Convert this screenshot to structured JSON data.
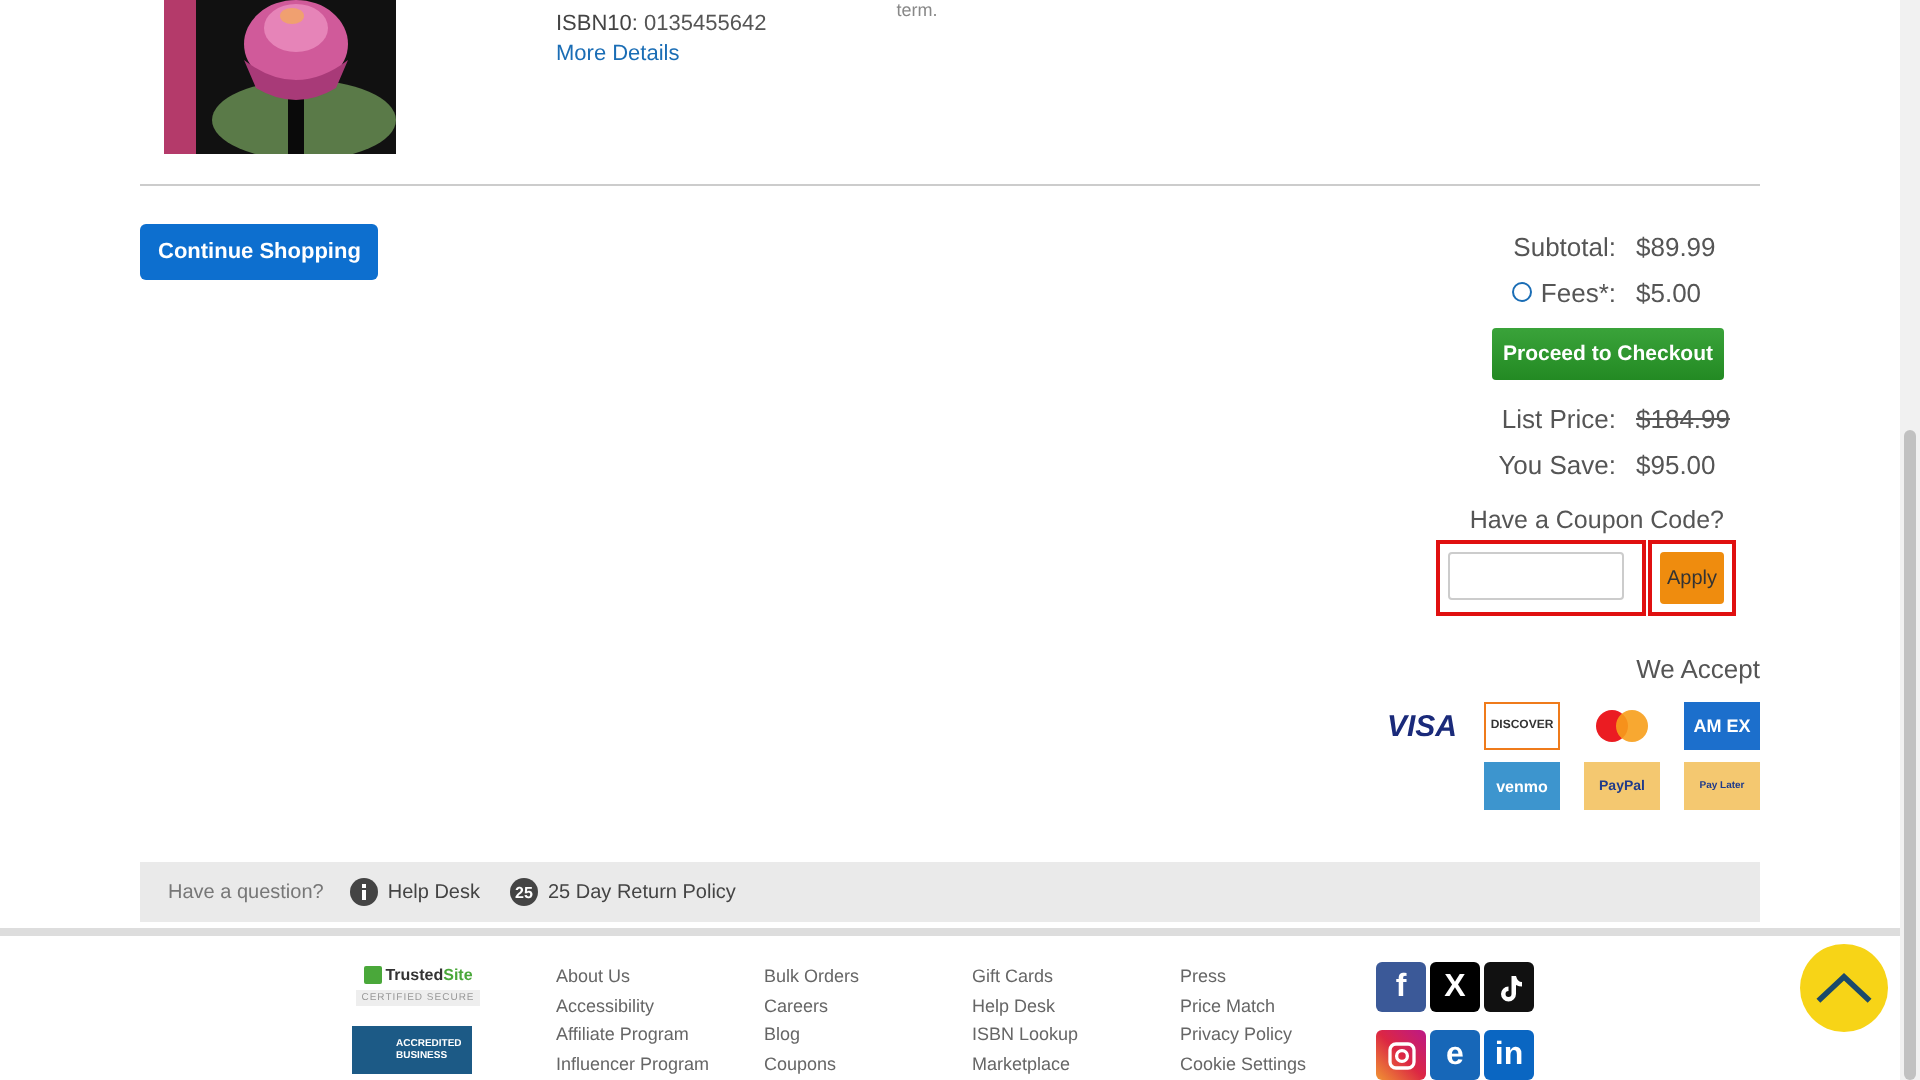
{
  "product": {
    "isbn10_label": "ISBN10:",
    "isbn10": "0135455642",
    "details_link": "More Details",
    "note": "term."
  },
  "continue_button": "Continue Shopping",
  "summary": {
    "rows": [
      {
        "label": "Subtotal:",
        "value": "$89.99",
        "info": false,
        "struck": false
      },
      {
        "label": "Fees*:",
        "value": "$5.00",
        "info": true,
        "struck": false
      }
    ],
    "checkout_button": "Proceed to Checkout",
    "savings": [
      {
        "label": "List Price:",
        "value": "$184.99",
        "struck": true
      },
      {
        "label": "You Save:",
        "value": "$95.00",
        "struck": false
      }
    ],
    "coupon_label": "Have a Coupon Code?",
    "apply_button": "Apply",
    "accept_label": "We Accept"
  },
  "payments": [
    {
      "label": "VISA",
      "kind": "plain"
    },
    {
      "label": "DISCOVER",
      "kind": "discover"
    },
    {
      "kind": "circles"
    },
    {
      "label": "AM EX",
      "kind": "amex"
    },
    {
      "label": "venmo",
      "kind": "venmo"
    },
    {
      "label": "PayPal",
      "kind": "paypal"
    },
    {
      "label": "Pay Later",
      "kind": "paylater"
    }
  ],
  "help_bar": {
    "question": "Have a question?",
    "help_desk": "Help Desk",
    "return_badge": "25",
    "return_policy": "25 Day Return Policy"
  },
  "badges": {
    "trusted_a": "Trusted",
    "trusted_b": "Site",
    "certified": "CERTIFIED SECURE",
    "bbb": "ACCREDITED BUSINESS"
  },
  "footer_columns": [
    [
      "About Us",
      "Accessibility",
      "Affiliate Program",
      "Influencer Program"
    ],
    [
      "Bulk Orders",
      "Careers",
      "Blog",
      "Coupons"
    ],
    [
      "Gift Cards",
      "Help Desk",
      "ISBN Lookup",
      "Marketplace"
    ],
    [
      "Press",
      "Price Match",
      "Privacy Policy",
      "Cookie Settings"
    ]
  ],
  "social": [
    {
      "kind": "facebook",
      "label": "f"
    },
    {
      "kind": "x",
      "label": "X"
    },
    {
      "kind": "tiktok"
    },
    {
      "kind": "instagram"
    },
    {
      "kind": "e",
      "label": "e"
    },
    {
      "kind": "linkedin",
      "label": "in"
    }
  ]
}
